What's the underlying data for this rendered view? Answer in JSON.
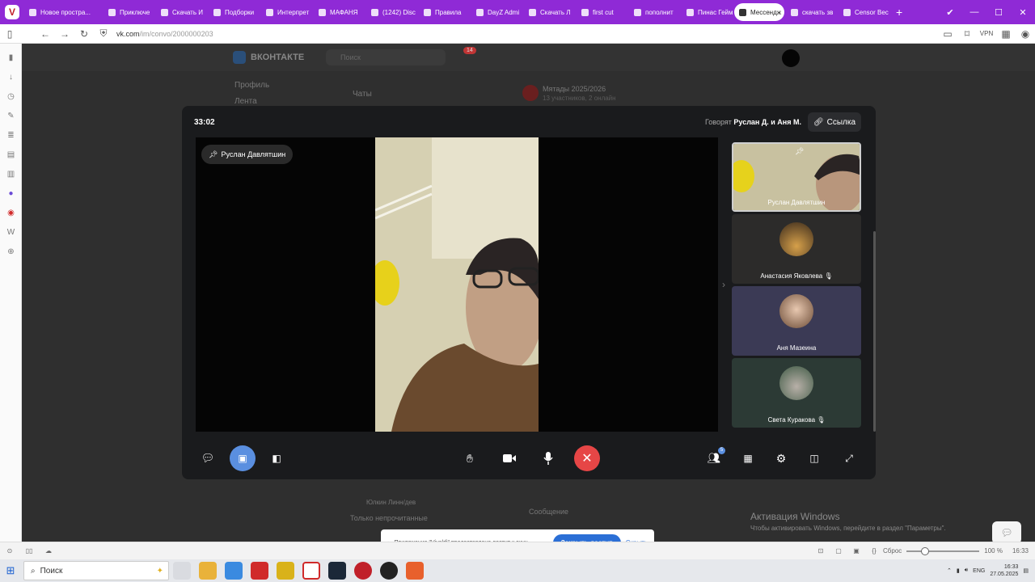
{
  "browser": {
    "tabs": [
      {
        "label": "Новое простра...",
        "active": false
      },
      {
        "label": "Приключе",
        "active": false
      },
      {
        "label": "Скачать И",
        "active": false
      },
      {
        "label": "Подборки",
        "active": false
      },
      {
        "label": "Интерпрет",
        "active": false
      },
      {
        "label": "МАФАНЯ",
        "active": false
      },
      {
        "label": "(1242) Disc",
        "active": false
      },
      {
        "label": "Правила",
        "active": false
      },
      {
        "label": "DayZ Admi",
        "active": false
      },
      {
        "label": "Скачать Л",
        "active": false
      },
      {
        "label": "first cut",
        "active": false
      },
      {
        "label": "пополнит",
        "active": false
      },
      {
        "label": "Пинас Гейм",
        "active": false
      },
      {
        "label": "Мессендж",
        "active": true
      },
      {
        "label": "скачать зв",
        "active": false
      },
      {
        "label": "Censor Bec",
        "active": false
      }
    ],
    "url_host": "vk.com",
    "url_path": "/im/convo/2000000203",
    "status_reset": "Сброс",
    "zoom": "100 %",
    "status_time": "16:33"
  },
  "vk_bg": {
    "logo": "ВКОНТАКТЕ",
    "search_placeholder": "Поиск",
    "notif_count": "14",
    "menu_profile": "Профиль",
    "menu_feed": "Лента",
    "chats_title": "Чаты",
    "convo_title": "Мятады 2025/2026",
    "convo_sub": "13 участников, 2 онлайн",
    "chat_item": "Юлкин Линн/дев",
    "only_unread": "Только непрочитанные",
    "message_placeholder": "Сообщение"
  },
  "call": {
    "timer": "33:02",
    "speaking_prefix": "Говорят",
    "speaking_names": "Руслан Д. и Аня М.",
    "link_label": "Ссылка",
    "pinned_name": "Руслан Давлятшин",
    "participants": [
      {
        "name": "Руслан Давлятшин",
        "bg": "#bfb795"
      },
      {
        "name": "Анастасия Яковлева",
        "bg": "#2c2b2a"
      },
      {
        "name": "Аня Мазеина",
        "bg": "#3b3a55"
      },
      {
        "name": "Света Куракова",
        "bg": "#2c3a35"
      }
    ],
    "people_badge": "5",
    "end_color": "#e64646",
    "accent": "#5a8fe0"
  },
  "windows_activation": {
    "title": "Активация Windows",
    "subtitle": "Чтобы активировать Windows, перейдите в раздел \"Параметры\"."
  },
  "notification": {
    "text": "Приложение \"Vivaldi\" предоставлено доступ к окну",
    "allow": "Закрыть доступ",
    "hide": "Скрыть"
  },
  "taskbar": {
    "search": "Поиск",
    "lang": "ENG",
    "time": "16:33",
    "date": "27.05.2025"
  }
}
